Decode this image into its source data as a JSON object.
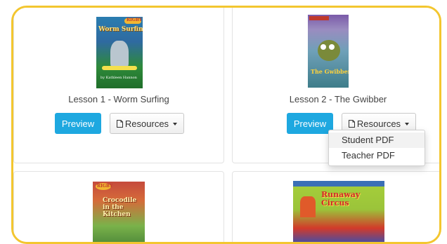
{
  "lessons": [
    {
      "title": "Lesson 1 - Worm Surfing",
      "cover_text": "Worm Surfing",
      "cover_series": "RIGBY",
      "cover_author": "by Kathleen Hannon"
    },
    {
      "title": "Lesson 2 - The Gwibber",
      "cover_text": "The Gwibber",
      "cover_series": "PM",
      "cover_author": ""
    },
    {
      "title": "",
      "cover_text": "Crocodile in the Kitchen",
      "cover_series": "RIGBY",
      "cover_author": ""
    },
    {
      "title": "",
      "cover_text": "Runaway Circus",
      "cover_series": "",
      "cover_author": ""
    }
  ],
  "buttons": {
    "preview": "Preview",
    "resources": "Resources"
  },
  "dropdown": {
    "items": [
      "Student PDF",
      "Teacher PDF"
    ]
  },
  "colors": {
    "frame": "#f3c62f",
    "preview": "#1ea8e0"
  }
}
